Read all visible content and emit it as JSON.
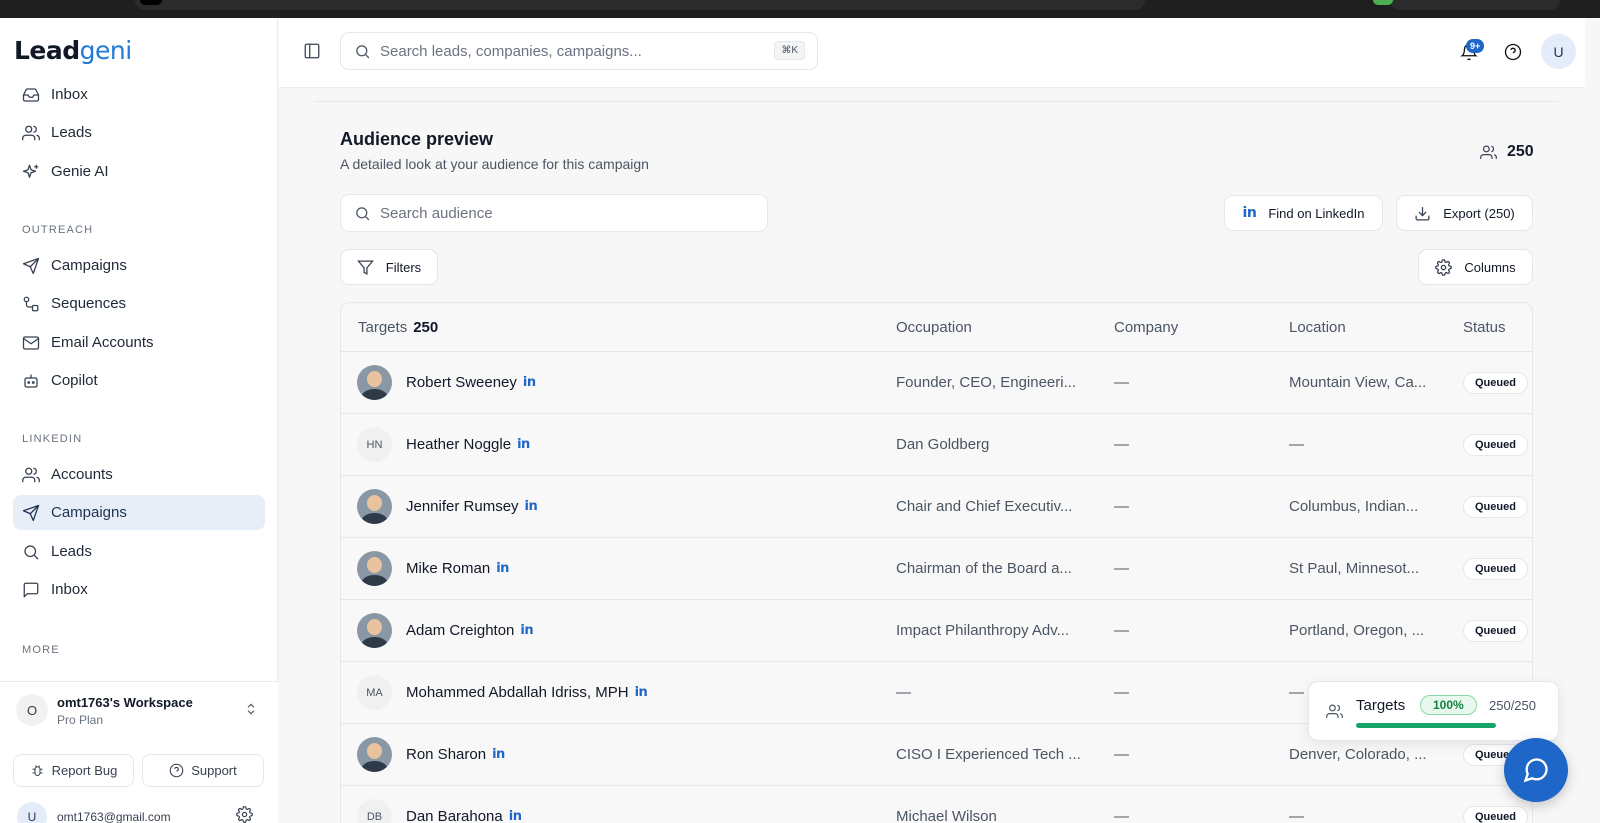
{
  "app": {
    "logo_main": "Lead",
    "logo_accent": "geni"
  },
  "sidebar": {
    "main_items": [
      {
        "label": "Inbox",
        "icon": "inbox-icon"
      },
      {
        "label": "Leads",
        "icon": "users-icon"
      },
      {
        "label": "Genie AI",
        "icon": "sparkle-icon"
      }
    ],
    "outreach_label": "OUTREACH",
    "outreach_items": [
      {
        "label": "Campaigns",
        "icon": "send-icon"
      },
      {
        "label": "Sequences",
        "icon": "sequence-icon"
      },
      {
        "label": "Email Accounts",
        "icon": "mail-icon"
      },
      {
        "label": "Copilot",
        "icon": "bot-icon"
      }
    ],
    "linkedin_label": "LINKEDIN",
    "linkedin_items": [
      {
        "label": "Accounts",
        "icon": "users-icon"
      },
      {
        "label": "Campaigns",
        "icon": "send-icon",
        "active": true
      },
      {
        "label": "Leads",
        "icon": "search-icon"
      },
      {
        "label": "Inbox",
        "icon": "message-icon"
      }
    ],
    "more_label": "MORE",
    "workspace": {
      "initial": "O",
      "name": "omt1763's Workspace",
      "plan": "Pro Plan"
    },
    "report_bug_label": "Report Bug",
    "support_label": "Support",
    "user": {
      "initial": "U",
      "email": "omt1763@gmail.com"
    }
  },
  "topbar": {
    "search_placeholder": "Search leads, companies, campaigns...",
    "shortcut": "⌘K",
    "notification_badge": "9+",
    "avatar_initial": "U"
  },
  "main": {
    "title": "Audience preview",
    "subtitle": "A detailed look at your audience for this campaign",
    "audience_count": "250",
    "search_placeholder": "Search audience",
    "find_linkedin_label": "Find on LinkedIn",
    "export_label": "Export (250)",
    "filters_label": "Filters",
    "columns_label": "Columns",
    "linkedin_mark": "in",
    "table": {
      "headers": {
        "targets": "Targets",
        "targets_count": "250",
        "occupation": "Occupation",
        "company": "Company",
        "location": "Location",
        "status": "Status"
      },
      "rows": [
        {
          "avatar": "",
          "photo": true,
          "name": "Robert Sweeney",
          "occupation": "Founder, CEO, Engineeri...",
          "company": "—",
          "location": "Mountain View, Ca...",
          "status": "Queued"
        },
        {
          "avatar": "HN",
          "photo": false,
          "name": "Heather Noggle",
          "occupation": "Dan Goldberg",
          "company": "—",
          "location": "—",
          "status": "Queued"
        },
        {
          "avatar": "",
          "photo": true,
          "name": "Jennifer Rumsey",
          "occupation": "Chair and Chief Executiv...",
          "company": "—",
          "location": "Columbus, Indian...",
          "status": "Queued"
        },
        {
          "avatar": "",
          "photo": true,
          "name": "Mike Roman",
          "occupation": "Chairman of the Board a...",
          "company": "—",
          "location": "St Paul, Minnesot...",
          "status": "Queued"
        },
        {
          "avatar": "",
          "photo": true,
          "name": "Adam Creighton",
          "occupation": "Impact Philanthropy Adv...",
          "company": "—",
          "location": "Portland, Oregon, ...",
          "status": "Queued"
        },
        {
          "avatar": "MA",
          "photo": false,
          "name": "Mohammed Abdallah Idriss, MPH",
          "occupation": "—",
          "company": "—",
          "location": "—",
          "status": ""
        },
        {
          "avatar": "",
          "photo": true,
          "name": "Ron Sharon",
          "occupation": "CISO I Experienced Tech ...",
          "company": "—",
          "location": "Denver, Colorado, ...",
          "status": "Queued"
        },
        {
          "avatar": "DB",
          "photo": false,
          "name": "Dan Barahona",
          "occupation": "Michael Wilson",
          "company": "—",
          "location": "—",
          "status": "Queued"
        }
      ]
    }
  },
  "progress": {
    "label": "Targets",
    "percent_label": "100%",
    "count": "250/250",
    "fraction": 1.0
  },
  "colors": {
    "accent": "#1e66c8",
    "success": "#16a36a"
  }
}
